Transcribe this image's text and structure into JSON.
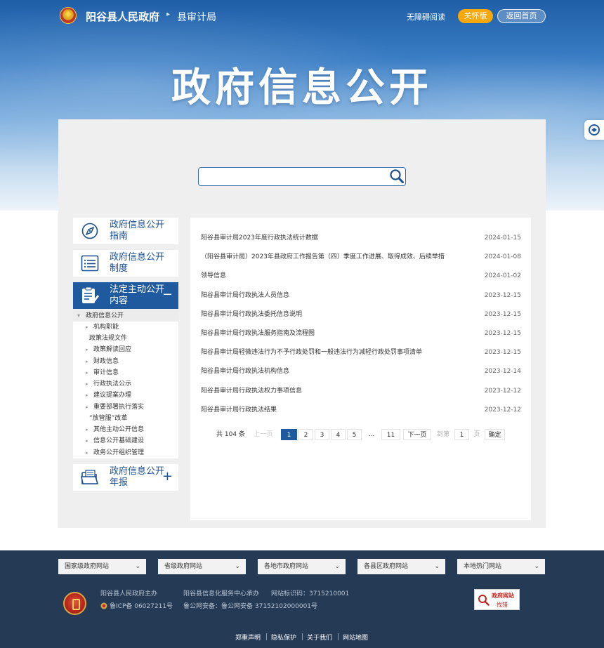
{
  "header": {
    "site_title": "阳谷县人民政府",
    "dept": "县审计局",
    "accessible": "无障碍阅读",
    "care_mode": "关怀版",
    "home": "返回首页"
  },
  "hero": {
    "title": "政府信息公开"
  },
  "search": {
    "placeholder": ""
  },
  "sidebar": {
    "items": [
      {
        "label": "政府信息公开指南",
        "icon": "compass-icon"
      },
      {
        "label": "政府信息公开制度",
        "icon": "list-icon"
      },
      {
        "label": "法定主动公开内容",
        "icon": "document-edit-icon",
        "toggle": "−"
      },
      {
        "label": "政府信息公开年报",
        "icon": "folder-icon",
        "toggle": "+"
      }
    ],
    "tree": {
      "root": "政府信息公开",
      "nodes": [
        "机构职能",
        "政策法规文件",
        "政策解读回应",
        "财政信息",
        "审计信息",
        "行政执法公示",
        "建议提案办理",
        "重要部署执行落实",
        "“放管服”改革",
        "其他主动公开信息",
        "信息公开基础建设",
        "政务公开组织管理"
      ]
    }
  },
  "list": {
    "rows": [
      {
        "title": "阳谷县审计局2023年度行政执法统计数据",
        "date": "2024-01-15"
      },
      {
        "title": "（阳谷县审计局）2023年县政府工作报告第（四）季度工作进展、取得成效、后续举措",
        "date": "2024-01-08"
      },
      {
        "title": "领导信息",
        "date": "2024-01-02"
      },
      {
        "title": "阳谷县审计局行政执法人员信息",
        "date": "2023-12-15"
      },
      {
        "title": "阳谷县审计局行政执法委托信息说明",
        "date": "2023-12-15"
      },
      {
        "title": "阳谷县审计局行政执法服务指南及流程图",
        "date": "2023-12-15"
      },
      {
        "title": "阳谷县审计局轻微违法行为不予行政处罚和一般违法行为减轻行政处罚事项清单",
        "date": "2023-12-15"
      },
      {
        "title": "阳谷县审计局行政执法机构信息",
        "date": "2023-12-14"
      },
      {
        "title": "阳谷县审计局行政执法权力事项信息",
        "date": "2023-12-12"
      },
      {
        "title": "阳谷县审计局行政执法结果",
        "date": "2023-12-12"
      }
    ]
  },
  "pagination": {
    "total": "共 104 条",
    "prev": "上一页",
    "pages": [
      "1",
      "2",
      "3",
      "4",
      "5",
      "...",
      "11"
    ],
    "current_page": 1,
    "next": "下一页",
    "goto": "到第",
    "goto_value": "1",
    "page_unit": "页",
    "confirm": "确定"
  },
  "footer": {
    "selects": [
      "国家级政府网站",
      "省级政府网站",
      "各地市政府网站",
      "各县区政府网站",
      "本地热门网站"
    ],
    "host": "阳谷县人民政府主办",
    "undertaker": "阳谷县信息化服务中心承办",
    "site_id": "网站标识码：3715210001",
    "icp": "鲁ICP备 06027211号",
    "police": "鲁公网安备：鲁公网安备 37152102000001号",
    "badge_line1": "政府网站",
    "badge_line2": "找错",
    "links": [
      "郑重声明",
      "隐私保护",
      "关于我们",
      "网站地图"
    ]
  },
  "colors": {
    "primary_blue": "#1f5a9f",
    "care_orange": "#f6a80c",
    "panel_gray": "#efefef",
    "footer_navy": "#243a55"
  }
}
